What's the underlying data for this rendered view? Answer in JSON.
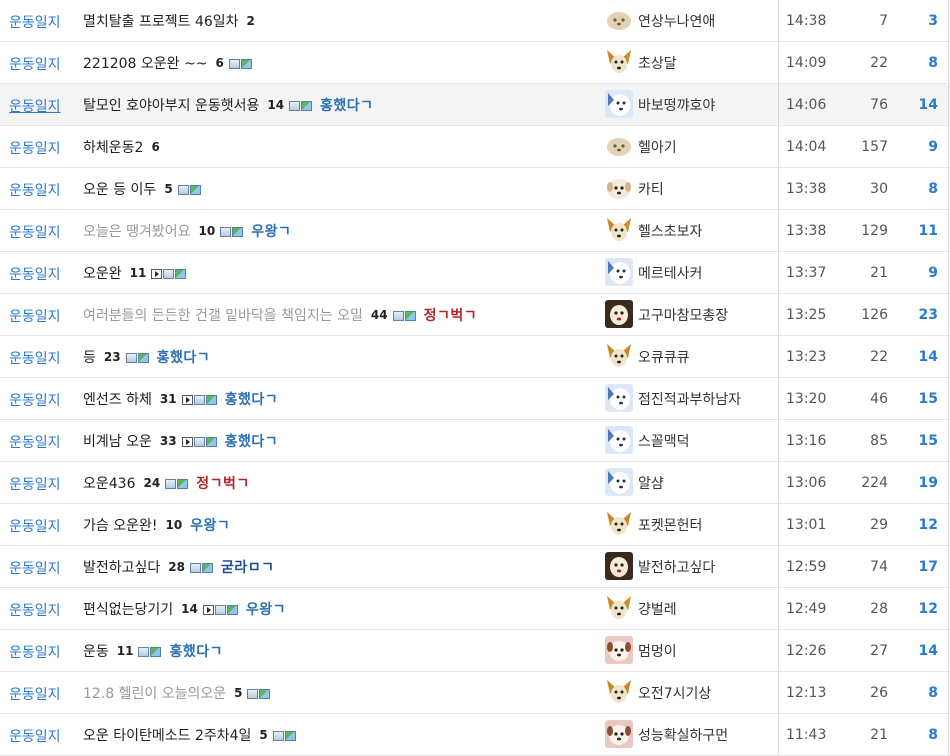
{
  "rows": [
    {
      "category": "운동일지",
      "title": "멸치탈출 프로젝트 46일차",
      "comments": "2",
      "icons": [],
      "badge": "",
      "badge_color": "",
      "writer": "연상누나연애",
      "avatar": "dog-face-icon",
      "time": "14:38",
      "views": "7",
      "likes": "3",
      "read": false
    },
    {
      "category": "운동일지",
      "title": "221208 오운완 ~~",
      "comments": "6",
      "icons": [
        "doc",
        "img"
      ],
      "badge": "",
      "badge_color": "",
      "writer": "초상달",
      "avatar": "dog-face-icon",
      "time": "14:09",
      "views": "22",
      "likes": "8",
      "read": false
    },
    {
      "category": "운동일지",
      "title": "탈모인 호야아부지 운동햇서용",
      "comments": "14",
      "icons": [
        "doc",
        "img"
      ],
      "badge": "홍했다ㄱ",
      "badge_color": "blue",
      "writer": "바보떵꺄호야",
      "avatar": "dog-face-icon",
      "time": "14:06",
      "views": "76",
      "likes": "14",
      "read": false,
      "hover": true
    },
    {
      "category": "운동일지",
      "title": "하체운동2",
      "comments": "6",
      "icons": [],
      "badge": "",
      "badge_color": "",
      "writer": "헬아기",
      "avatar": "dog-face-icon",
      "time": "14:04",
      "views": "157",
      "likes": "9",
      "read": false
    },
    {
      "category": "운동일지",
      "title": "오운 등 이두",
      "comments": "5",
      "icons": [
        "doc",
        "img"
      ],
      "badge": "",
      "badge_color": "",
      "writer": "카티",
      "avatar": "dog-face-icon",
      "time": "13:38",
      "views": "30",
      "likes": "8",
      "read": false
    },
    {
      "category": "운동일지",
      "title": "오늘은 땡겨봤어요",
      "comments": "10",
      "icons": [
        "doc",
        "img"
      ],
      "badge": "우왕ㄱ",
      "badge_color": "blue",
      "writer": "헬스초보자",
      "avatar": "dog-face-icon",
      "time": "13:38",
      "views": "129",
      "likes": "11",
      "read": true
    },
    {
      "category": "운동일지",
      "title": "오운완",
      "comments": "11",
      "icons": [
        "vid",
        "doc",
        "img"
      ],
      "badge": "",
      "badge_color": "",
      "writer": "메르테사커",
      "avatar": "dog-face-icon",
      "time": "13:37",
      "views": "21",
      "likes": "9",
      "read": false
    },
    {
      "category": "운동일지",
      "title": "여러분들의 든든한 건갤 밑바닥을 책임지는 오밀",
      "comments": "44",
      "icons": [
        "doc",
        "img"
      ],
      "badge": "정ㄱ벅ㄱ",
      "badge_color": "red",
      "writer": "고구마참모총장",
      "avatar": "dog-face-icon",
      "time": "13:25",
      "views": "126",
      "likes": "23",
      "read": true
    },
    {
      "category": "운동일지",
      "title": "등",
      "comments": "23",
      "icons": [
        "doc",
        "img"
      ],
      "badge": "홍했다ㄱ",
      "badge_color": "blue",
      "writer": "오큐큐큐",
      "avatar": "dog-face-icon",
      "time": "13:23",
      "views": "22",
      "likes": "14",
      "read": false
    },
    {
      "category": "운동일지",
      "title": "엔선즈 하체",
      "comments": "31",
      "icons": [
        "vid",
        "doc",
        "img"
      ],
      "badge": "홍했다ㄱ",
      "badge_color": "blue",
      "writer": "점진적과부하남자",
      "avatar": "dog-face-icon",
      "time": "13:20",
      "views": "46",
      "likes": "15",
      "read": false
    },
    {
      "category": "운동일지",
      "title": "비계남 오운",
      "comments": "33",
      "icons": [
        "vid",
        "doc",
        "img"
      ],
      "badge": "홍했다ㄱ",
      "badge_color": "blue",
      "writer": "스꼴맥덕",
      "avatar": "dog-face-icon",
      "time": "13:16",
      "views": "85",
      "likes": "15",
      "read": false
    },
    {
      "category": "운동일지",
      "title": "오운436",
      "comments": "24",
      "icons": [
        "doc",
        "img"
      ],
      "badge": "정ㄱ벅ㄱ",
      "badge_color": "red",
      "writer": "알샴",
      "avatar": "dog-face-icon",
      "time": "13:06",
      "views": "224",
      "likes": "19",
      "read": false
    },
    {
      "category": "운동일지",
      "title": "가슴 오운완!",
      "comments": "10",
      "icons": [],
      "badge": "우왕ㄱ",
      "badge_color": "blue",
      "writer": "포켓몬헌터",
      "avatar": "dog-face-icon",
      "time": "13:01",
      "views": "29",
      "likes": "12",
      "read": false
    },
    {
      "category": "운동일지",
      "title": "발전하고싶다",
      "comments": "28",
      "icons": [
        "doc",
        "img"
      ],
      "badge": "굳라ㅁㄱ",
      "badge_color": "bblue",
      "writer": "발전하고싶다",
      "avatar": "dog-face-icon",
      "time": "12:59",
      "views": "74",
      "likes": "17",
      "read": false
    },
    {
      "category": "운동일지",
      "title": "편식없는당기기",
      "comments": "14",
      "icons": [
        "vid",
        "doc",
        "img"
      ],
      "badge": "우왕ㄱ",
      "badge_color": "blue",
      "writer": "걍벌레",
      "avatar": "dog-face-icon",
      "time": "12:49",
      "views": "28",
      "likes": "12",
      "read": false
    },
    {
      "category": "운동일지",
      "title": "운동",
      "comments": "11",
      "icons": [
        "doc",
        "img"
      ],
      "badge": "홍했다ㄱ",
      "badge_color": "blue",
      "writer": "멈멍이",
      "avatar": "dog-face-icon",
      "time": "12:26",
      "views": "27",
      "likes": "14",
      "read": false
    },
    {
      "category": "운동일지",
      "title": "12.8 헬린이 오늘의오운",
      "comments": "5",
      "icons": [
        "doc",
        "img"
      ],
      "badge": "",
      "badge_color": "",
      "writer": "오전7시기상",
      "avatar": "dog-face-icon",
      "time": "12:13",
      "views": "26",
      "likes": "8",
      "read": true
    },
    {
      "category": "운동일지",
      "title": "오운 타이탄메소드 2주차4일",
      "comments": "5",
      "icons": [
        "doc",
        "img"
      ],
      "badge": "",
      "badge_color": "",
      "writer": "성능확실하구먼",
      "avatar": "dog-face-icon",
      "time": "11:43",
      "views": "21",
      "likes": "8",
      "read": false
    }
  ],
  "avatar_styles": [
    "tan",
    "dog",
    "blue",
    "tan",
    "white",
    "dog",
    "blue",
    "brown",
    "dog",
    "blue",
    "blue",
    "blue",
    "dog",
    "brown",
    "dog",
    "pink",
    "dog",
    "pink"
  ],
  "colors": {
    "category": "#2a7bd0",
    "likes": "#2a7bd0",
    "badge_blue": "#2b6fb5",
    "badge_red": "#b0262a",
    "read_title": "#999999"
  }
}
